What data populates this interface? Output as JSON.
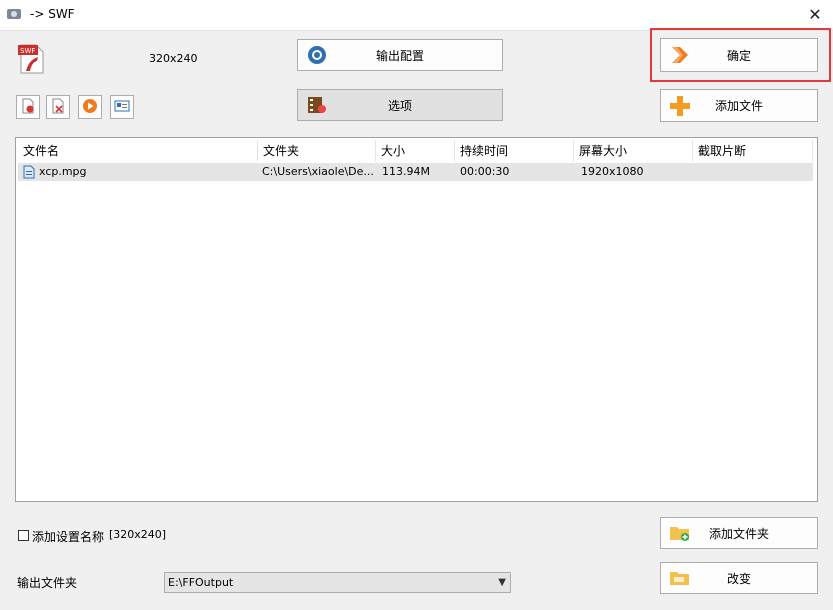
{
  "window": {
    "title": "-> SWF",
    "close_glyph": "✕"
  },
  "profile": {
    "resolution": "320x240"
  },
  "buttons": {
    "output_config": "输出配置",
    "options": "选项",
    "ok": "确定",
    "add_file": "添加文件",
    "add_folder": "添加文件夹",
    "change": "改变"
  },
  "table": {
    "columns": [
      "文件名",
      "文件夹",
      "大小",
      "持续时间",
      "屏幕大小",
      "截取片断"
    ],
    "rows": [
      {
        "name": "xcp.mpg",
        "folder": "C:\\Users\\xiaole\\De...",
        "size": "113.94M",
        "duration": "00:00:30",
        "screen": "1920x1080",
        "clip": ""
      }
    ]
  },
  "settings": {
    "add_setting_name_label": "添加设置名称",
    "add_setting_name_value": "[320x240]",
    "output_folder_label": "输出文件夹",
    "output_folder_value": "E:\\FFOutput"
  },
  "colors": {
    "highlight": "#e0393e",
    "ok_arrow": "#f07a22",
    "add_plus": "#f39c1f"
  }
}
